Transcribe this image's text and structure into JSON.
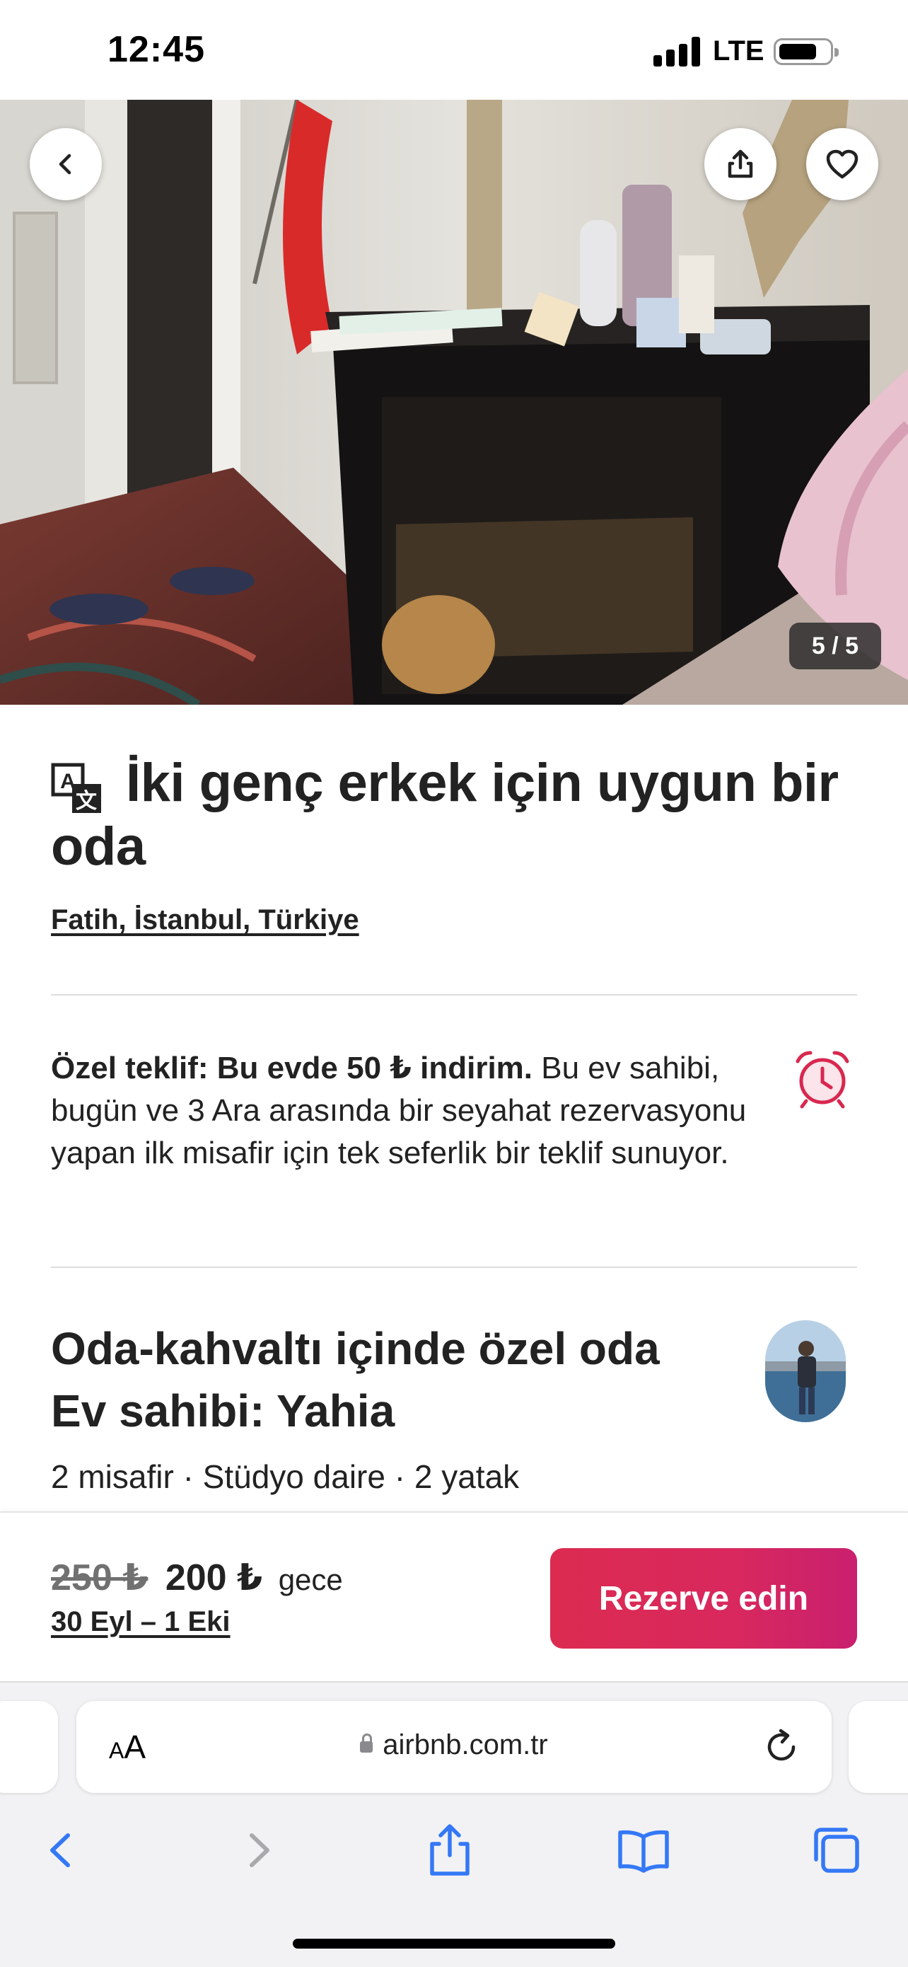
{
  "status_bar": {
    "time": "12:45",
    "network": "LTE"
  },
  "photo": {
    "counter": "5 / 5"
  },
  "listing": {
    "title": "İki genç erkek için uygun bir oda",
    "location": "Fatih, İstanbul, Türkiye"
  },
  "offer": {
    "bold": "Özel teklif: Bu evde 50 ₺ indirim.",
    "text": " Bu ev sahibi, bugün ve 3 Ara arasında bir seyahat rezervasyonu yapan ilk misafir için tek seferlik bir teklif sunuyor."
  },
  "room": {
    "type": "Oda-kahvaltı içinde özel oda",
    "host": "Ev sahibi: Yahia",
    "specs": "2 misafir · Stüdyo daire · 2 yatak"
  },
  "booking": {
    "old_price": "250 ₺",
    "new_price": "200 ₺",
    "per_night": "gece",
    "dates": "30 Eyl – 1 Eki",
    "reserve_label": "Rezerve edin"
  },
  "browser": {
    "aa_small": "A",
    "aa_large": "A",
    "url": "airbnb.com.tr"
  },
  "colors": {
    "brand": "#dc2b50",
    "ios_blue": "#3478f6"
  }
}
